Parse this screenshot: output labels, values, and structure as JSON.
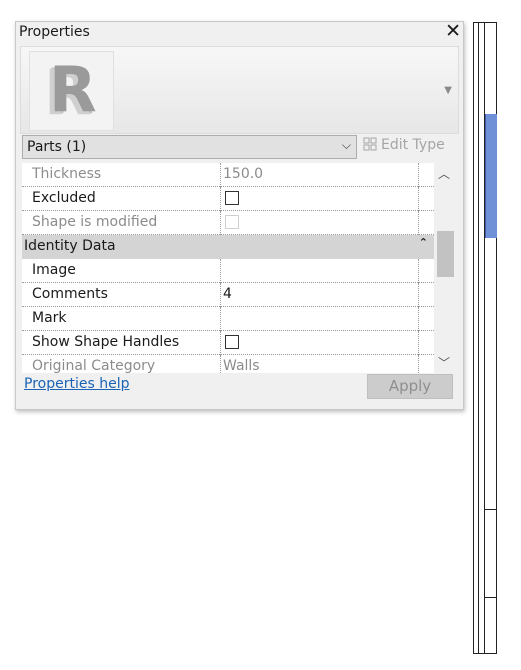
{
  "palette": {
    "title": "Properties",
    "close_glyph": "✕",
    "logo_letter": "R",
    "type_selector": {
      "value": "Parts (1)"
    },
    "edit_type_label": "Edit Type",
    "rows": [
      {
        "name": "Thickness",
        "value": "150.0",
        "state": "readonly"
      },
      {
        "name": "Excluded",
        "control": "checkbox",
        "checked": false
      },
      {
        "name": "Shape is modified",
        "control": "checkbox",
        "checked": false,
        "state": "disabled"
      }
    ],
    "group": {
      "name": "Identity Data",
      "collapse_icon": "chevron-up-double-icon"
    },
    "group_rows": [
      {
        "name": "Image",
        "value": ""
      },
      {
        "name": "Comments",
        "value": "4"
      },
      {
        "name": "Mark",
        "value": ""
      },
      {
        "name": "Show Shape Handles",
        "control": "checkbox",
        "checked": false
      },
      {
        "name": "Original Category",
        "value": "Walls",
        "state": "readonly"
      }
    ],
    "help_link": "Properties help",
    "apply_label": "Apply"
  }
}
